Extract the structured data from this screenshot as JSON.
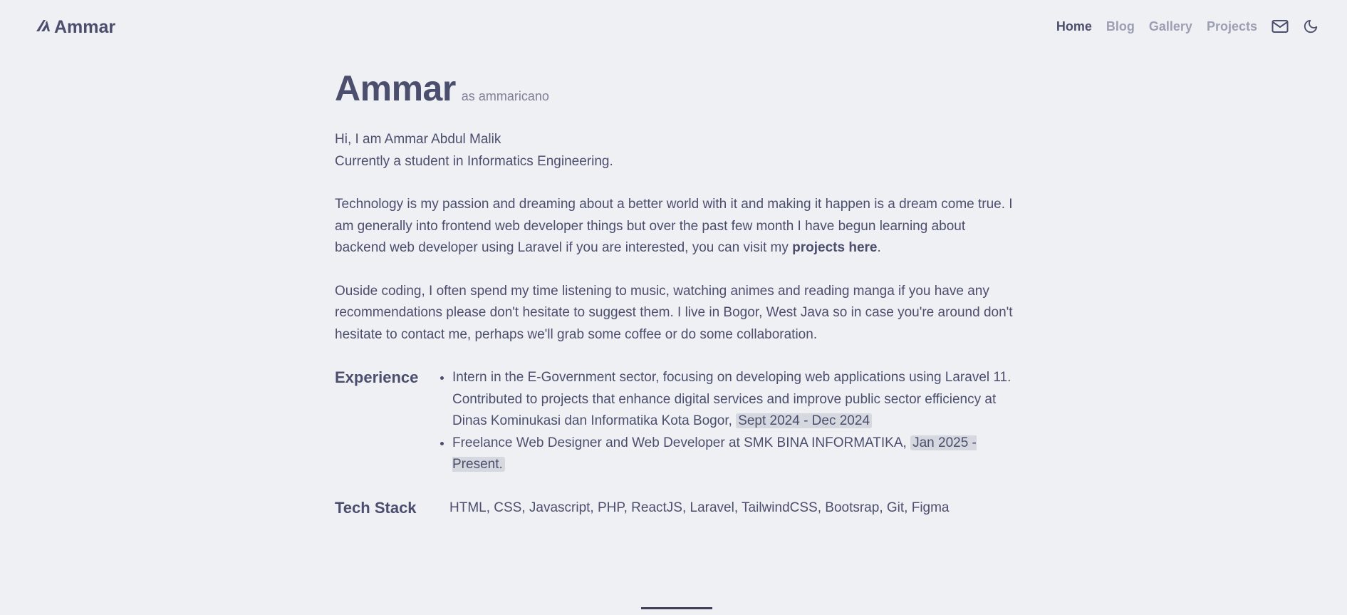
{
  "nav": {
    "logo_text": "Ammar",
    "links": [
      {
        "label": "Home",
        "active": true
      },
      {
        "label": "Blog",
        "active": false
      },
      {
        "label": "Gallery",
        "active": false
      },
      {
        "label": "Projects",
        "active": false
      }
    ],
    "icons": [
      "mail-icon",
      "moon-icon"
    ]
  },
  "hero": {
    "name": "Ammar",
    "as_label": "as",
    "handle": "ammaricano"
  },
  "intro": {
    "line1": "Hi, I am Ammar Abdul Malik",
    "line2": "Currently a student in Informatics Engineering.",
    "para2_text": "Technology is my passion and dreaming about a better world with it and making it happen is a dream come true. I am generally into frontend web developer things but over the past few month I have begun learning about backend web developer using Laravel if you are interested, you can visit my ",
    "para2_link": "projects here",
    "para2_end": ".",
    "para3": "Ouside coding, I often spend my time listening to music, watching animes and reading manga if you have any recommendations please don't hesitate to suggest them. I live in Bogor, West Java so in case you're around don't hesitate to contact me, perhaps we'll grab some coffee or do some collaboration."
  },
  "experience": {
    "label": "Experience",
    "items": [
      {
        "text": "Intern in the E-Government sector, focusing on developing web applications using Laravel 11. Contributed to projects that enhance digital services and improve public sector efficiency at Dinas Kominukasi dan Informatika Kota Bogor, ",
        "date": "Sept 2024 - Dec 2024"
      },
      {
        "text": "Freelance Web Designer and Web Developer at SMK BINA INFORMATIKA, ",
        "date": "Jan 2025 - Present."
      }
    ]
  },
  "tech_stack": {
    "label": "Tech Stack",
    "value": "HTML, CSS, Javascript, PHP, ReactJS, Laravel, TailwindCSS, Bootsrap, Git, Figma"
  }
}
